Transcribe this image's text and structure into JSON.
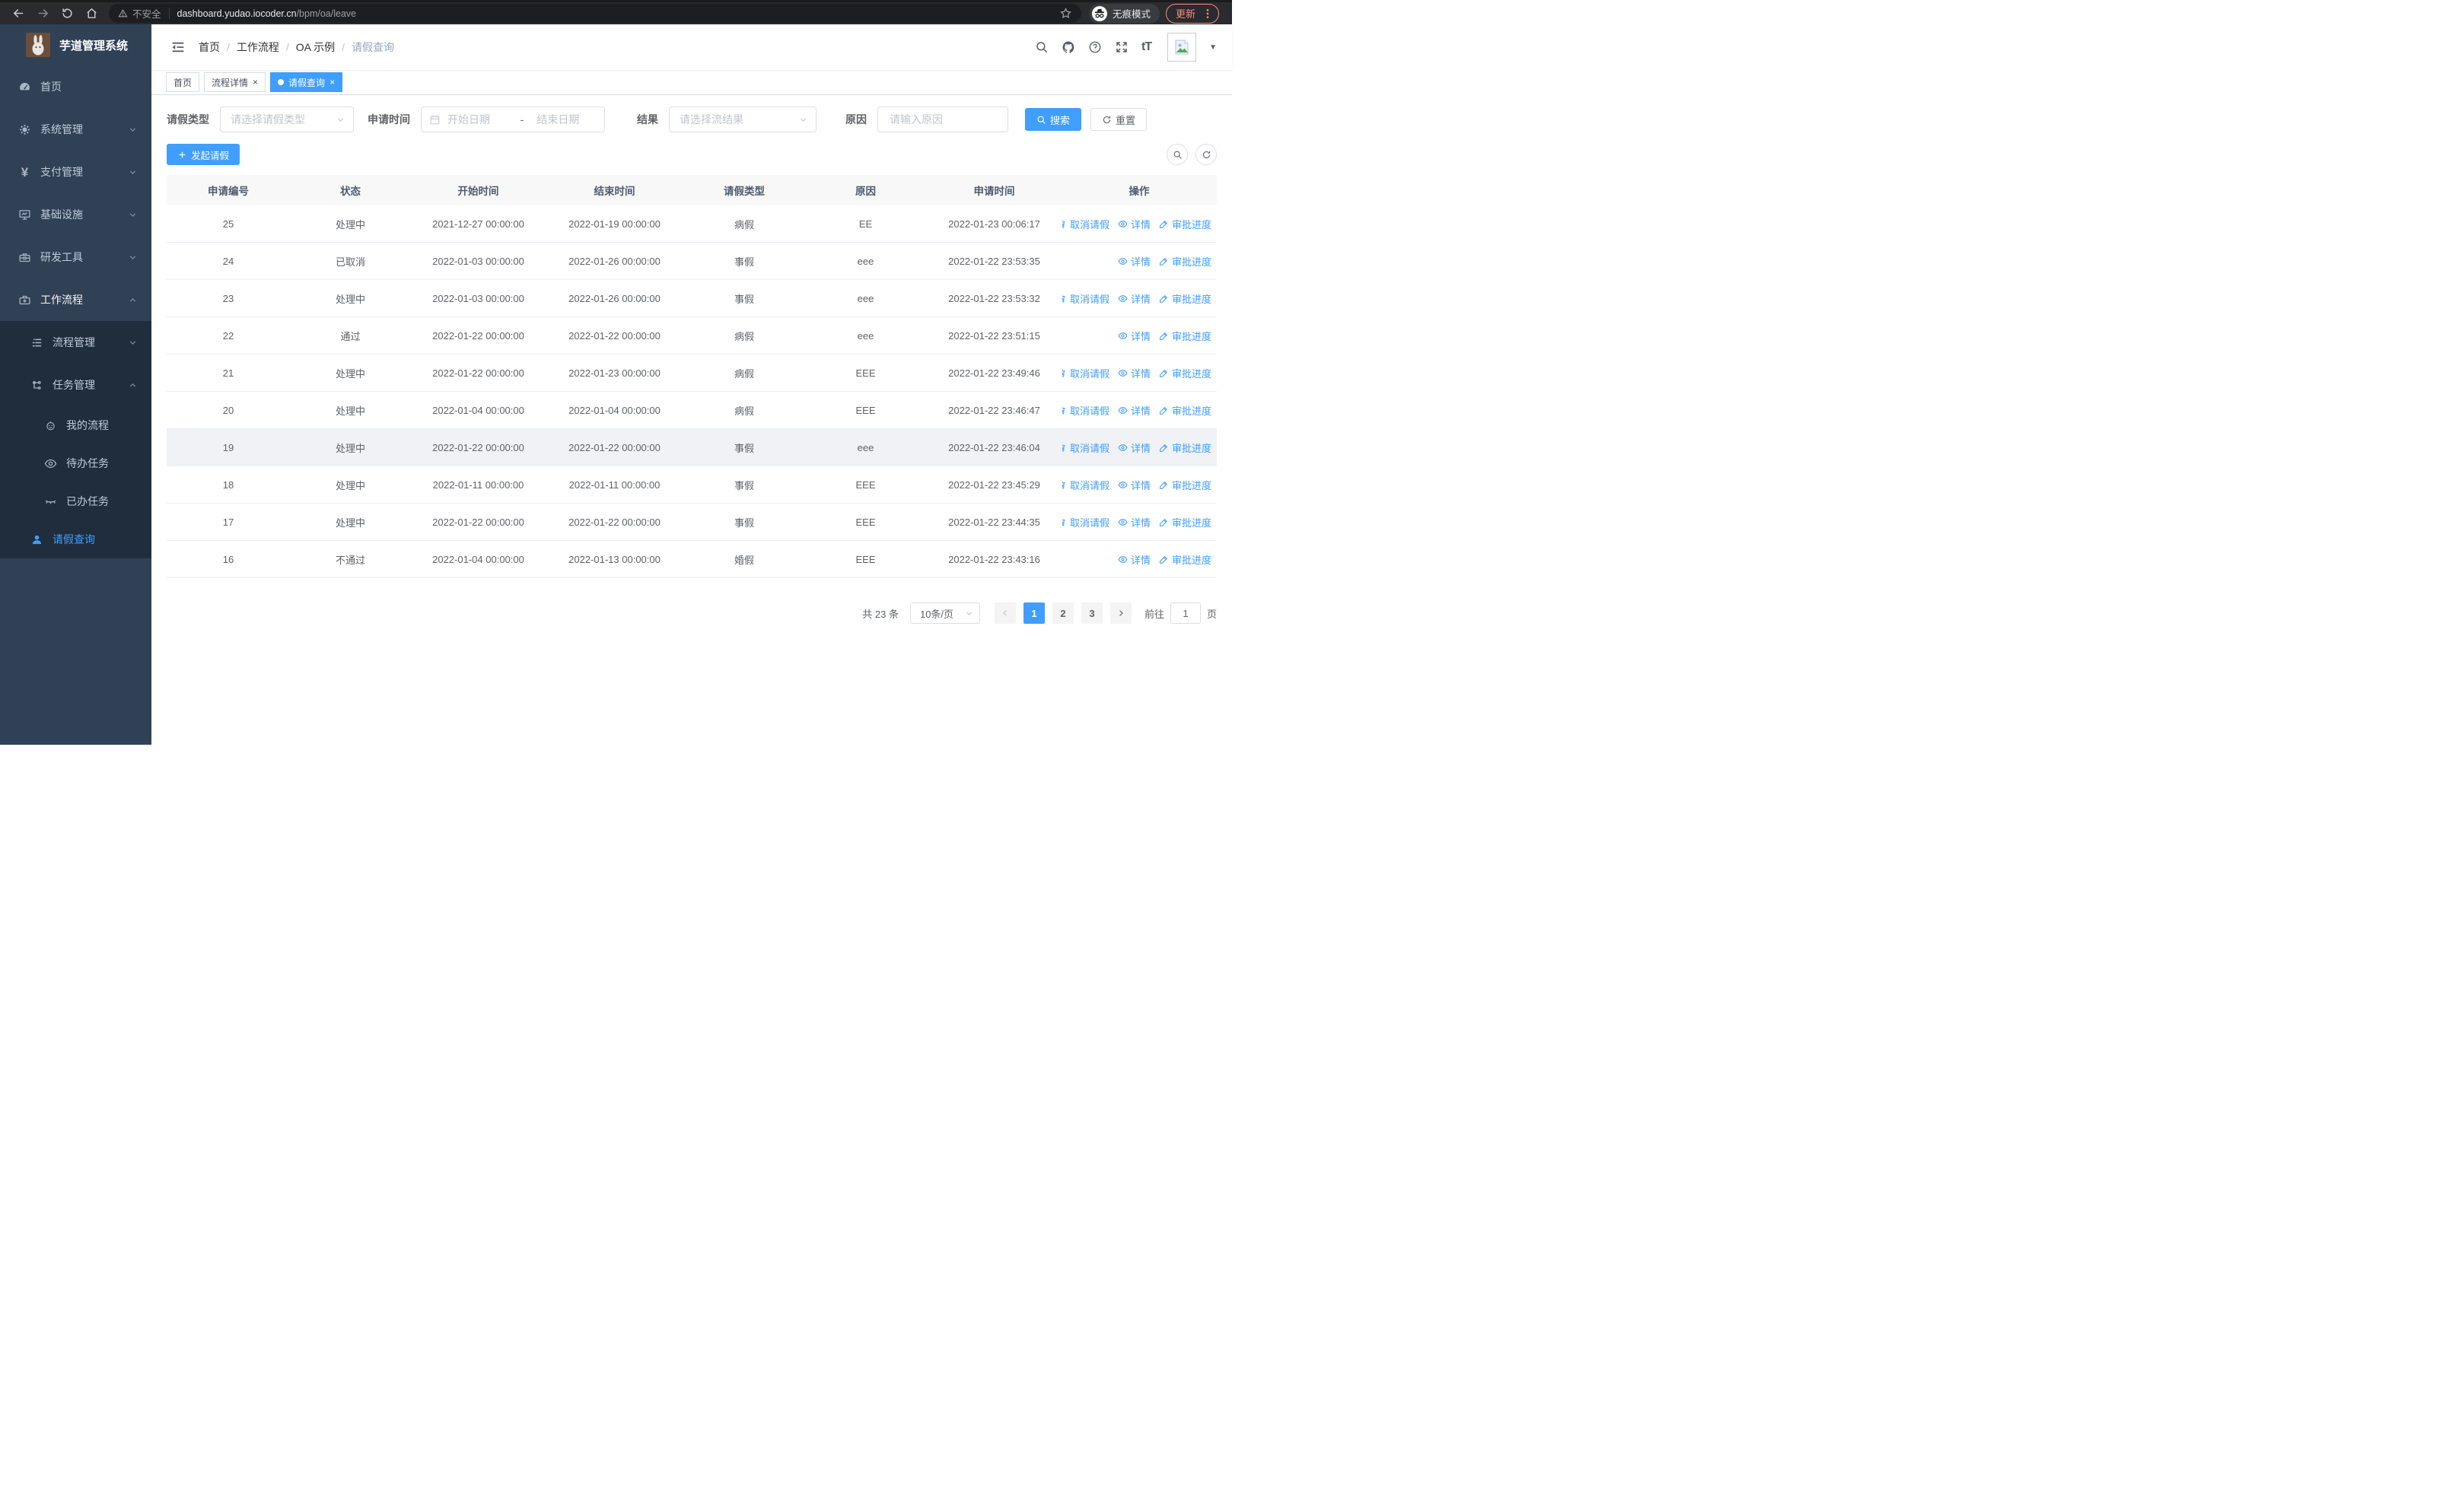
{
  "browser": {
    "security_label": "不安全",
    "url_host": "dashboard.yudao.iocoder.cn",
    "url_path": "/bpm/oa/leave",
    "incognito_label": "无痕模式",
    "update_label": "更新"
  },
  "sidebar": {
    "logo_title": "芋道管理系统",
    "home": "首页",
    "system": "系统管理",
    "payment": "支付管理",
    "infra": "基础设施",
    "dev_tools": "研发工具",
    "workflow": "工作流程",
    "process_mgmt": "流程管理",
    "task_mgmt": "任务管理",
    "my_process": "我的流程",
    "todo_tasks": "待办任务",
    "done_tasks": "已办任务",
    "leave_query": "请假查询"
  },
  "header": {
    "breadcrumb": {
      "home": "首页",
      "l1": "工作流程",
      "l2": "OA 示例",
      "current": "请假查询"
    },
    "font_icon_text": "tT",
    "caret_glyph": "▼"
  },
  "tabs": [
    {
      "label": "首页",
      "closable": false,
      "active": false
    },
    {
      "label": "流程详情",
      "closable": true,
      "active": false
    },
    {
      "label": "请假查询",
      "closable": true,
      "active": true
    }
  ],
  "ui": {
    "close_glyph": "×"
  },
  "filters": {
    "leave_type_label": "请假类型",
    "leave_type_placeholder": "请选择请假类型",
    "apply_time_label": "申请时间",
    "start_placeholder": "开始日期",
    "range_separator": "-",
    "end_placeholder": "结束日期",
    "result_label": "结果",
    "result_placeholder": "请选择流结果",
    "reason_label": "原因",
    "reason_placeholder": "请输入原因",
    "search_label": "搜索",
    "reset_label": "重置"
  },
  "toolbar": {
    "create_label": "发起请假"
  },
  "table": {
    "columns": [
      "申请编号",
      "状态",
      "开始时间",
      "结束时间",
      "请假类型",
      "原因",
      "申请时间",
      "操作"
    ],
    "rows": [
      {
        "id": "25",
        "status": "处理中",
        "start_time": "2021-12-27 00:00:00",
        "end_time": "2022-01-19 00:00:00",
        "leave_type": "病假",
        "reason": "EE",
        "apply_time": "2022-01-23 00:06:17",
        "highlighted": false,
        "actions": [
          {
            "name": "cancel",
            "icon": "trash",
            "label": "取消请假"
          },
          {
            "name": "detail",
            "icon": "eye",
            "label": "详情"
          },
          {
            "name": "progress",
            "icon": "pen",
            "label": "审批进度"
          }
        ]
      },
      {
        "id": "24",
        "status": "已取消",
        "start_time": "2022-01-03 00:00:00",
        "end_time": "2022-01-26 00:00:00",
        "leave_type": "事假",
        "reason": "eee",
        "apply_time": "2022-01-22 23:53:35",
        "highlighted": false,
        "actions": [
          {
            "name": "detail",
            "icon": "eye",
            "label": "详情"
          },
          {
            "name": "progress",
            "icon": "pen",
            "label": "审批进度"
          }
        ]
      },
      {
        "id": "23",
        "status": "处理中",
        "start_time": "2022-01-03 00:00:00",
        "end_time": "2022-01-26 00:00:00",
        "leave_type": "事假",
        "reason": "eee",
        "apply_time": "2022-01-22 23:53:32",
        "highlighted": false,
        "actions": [
          {
            "name": "cancel",
            "icon": "trash",
            "label": "取消请假"
          },
          {
            "name": "detail",
            "icon": "eye",
            "label": "详情"
          },
          {
            "name": "progress",
            "icon": "pen",
            "label": "审批进度"
          }
        ]
      },
      {
        "id": "22",
        "status": "通过",
        "start_time": "2022-01-22 00:00:00",
        "end_time": "2022-01-22 00:00:00",
        "leave_type": "病假",
        "reason": "eee",
        "apply_time": "2022-01-22 23:51:15",
        "highlighted": false,
        "actions": [
          {
            "name": "detail",
            "icon": "eye",
            "label": "详情"
          },
          {
            "name": "progress",
            "icon": "pen",
            "label": "审批进度"
          }
        ]
      },
      {
        "id": "21",
        "status": "处理中",
        "start_time": "2022-01-22 00:00:00",
        "end_time": "2022-01-23 00:00:00",
        "leave_type": "病假",
        "reason": "EEE",
        "apply_time": "2022-01-22 23:49:46",
        "highlighted": false,
        "actions": [
          {
            "name": "cancel",
            "icon": "trash",
            "label": "取消请假"
          },
          {
            "name": "detail",
            "icon": "eye",
            "label": "详情"
          },
          {
            "name": "progress",
            "icon": "pen",
            "label": "审批进度"
          }
        ]
      },
      {
        "id": "20",
        "status": "处理中",
        "start_time": "2022-01-04 00:00:00",
        "end_time": "2022-01-04 00:00:00",
        "leave_type": "病假",
        "reason": "EEE",
        "apply_time": "2022-01-22 23:46:47",
        "highlighted": false,
        "actions": [
          {
            "name": "cancel",
            "icon": "trash",
            "label": "取消请假"
          },
          {
            "name": "detail",
            "icon": "eye",
            "label": "详情"
          },
          {
            "name": "progress",
            "icon": "pen",
            "label": "审批进度"
          }
        ]
      },
      {
        "id": "19",
        "status": "处理中",
        "start_time": "2022-01-22 00:00:00",
        "end_time": "2022-01-22 00:00:00",
        "leave_type": "事假",
        "reason": "eee",
        "apply_time": "2022-01-22 23:46:04",
        "highlighted": true,
        "actions": [
          {
            "name": "cancel",
            "icon": "trash",
            "label": "取消请假"
          },
          {
            "name": "detail",
            "icon": "eye",
            "label": "详情"
          },
          {
            "name": "progress",
            "icon": "pen",
            "label": "审批进度"
          }
        ]
      },
      {
        "id": "18",
        "status": "处理中",
        "start_time": "2022-01-11 00:00:00",
        "end_time": "2022-01-11 00:00:00",
        "leave_type": "事假",
        "reason": "EEE",
        "apply_time": "2022-01-22 23:45:29",
        "highlighted": false,
        "actions": [
          {
            "name": "cancel",
            "icon": "trash",
            "label": "取消请假"
          },
          {
            "name": "detail",
            "icon": "eye",
            "label": "详情"
          },
          {
            "name": "progress",
            "icon": "pen",
            "label": "审批进度"
          }
        ]
      },
      {
        "id": "17",
        "status": "处理中",
        "start_time": "2022-01-22 00:00:00",
        "end_time": "2022-01-22 00:00:00",
        "leave_type": "事假",
        "reason": "EEE",
        "apply_time": "2022-01-22 23:44:35",
        "highlighted": false,
        "actions": [
          {
            "name": "cancel",
            "icon": "trash",
            "label": "取消请假"
          },
          {
            "name": "detail",
            "icon": "eye",
            "label": "详情"
          },
          {
            "name": "progress",
            "icon": "pen",
            "label": "审批进度"
          }
        ]
      },
      {
        "id": "16",
        "status": "不通过",
        "start_time": "2022-01-04 00:00:00",
        "end_time": "2022-01-13 00:00:00",
        "leave_type": "婚假",
        "reason": "EEE",
        "apply_time": "2022-01-22 23:43:16",
        "highlighted": false,
        "actions": [
          {
            "name": "detail",
            "icon": "eye",
            "label": "详情"
          },
          {
            "name": "progress",
            "icon": "pen",
            "label": "审批进度"
          }
        ]
      }
    ]
  },
  "pagination": {
    "total_label": "共 23 条",
    "page_size": "10条/页",
    "pages": [
      "1",
      "2",
      "3"
    ],
    "active_page": "1",
    "jump_label": "前往",
    "jump_value": "1",
    "jump_suffix": "页"
  },
  "colors": {
    "primary": "#409eff",
    "sidebar_bg": "#304156",
    "submenu_bg": "#1f2d3d",
    "update_accent": "#ef8d84"
  }
}
